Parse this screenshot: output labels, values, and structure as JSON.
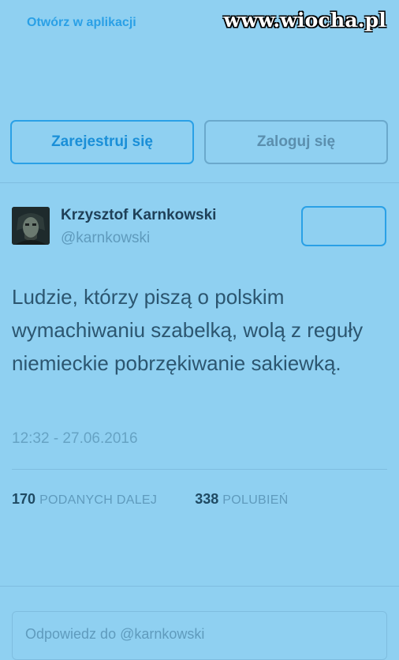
{
  "header": {
    "open_app_label": "Otwórz w aplikacji",
    "watermark": "www.wiocha.pl"
  },
  "auth": {
    "register_label": "Zarejestruj się",
    "login_label": "Zaloguj się"
  },
  "tweet": {
    "author_name": "Krzysztof Karnkowski",
    "handle": "@karnkowski",
    "text": "Ludzie, którzy piszą o polskim wymachiwaniu szabelką, wolą z reguły niemieckie pobrzękiwanie sakiewką.",
    "timestamp": "12:32 - 27.06.2016",
    "retweets_count": "170",
    "retweets_label": "PODANYCH DALEJ",
    "likes_count": "338",
    "likes_label": "POLUBIEŃ"
  },
  "reply": {
    "placeholder": "Odpowiedz do @karnkowski"
  },
  "colors": {
    "background": "#8fd0f1",
    "accent": "#2aa0e6"
  }
}
